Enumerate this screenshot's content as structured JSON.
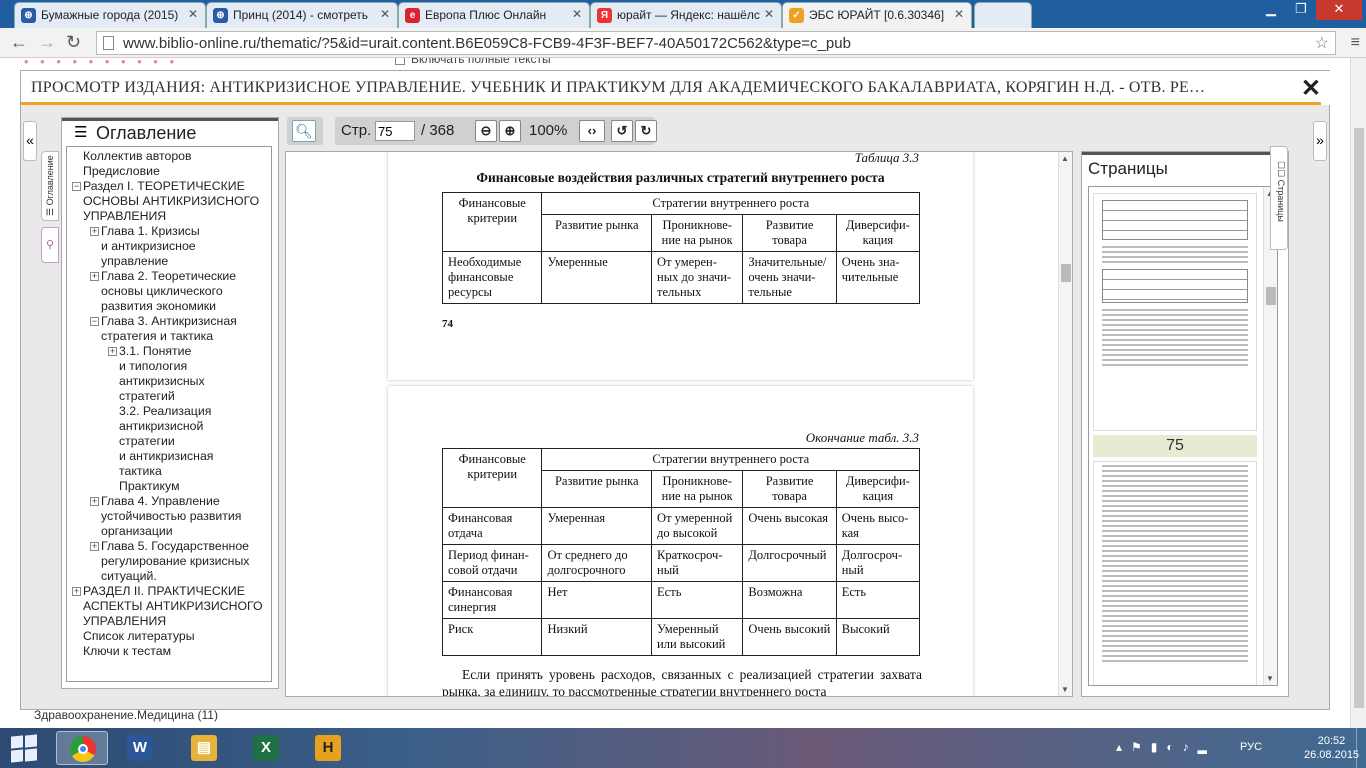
{
  "browser": {
    "tabs": [
      {
        "title": "Бумажные города (2015)",
        "favicon_color": "#2a5ba8",
        "left": 0
      },
      {
        "title": "Принц (2014) - смотреть",
        "favicon_color": "#2a5ba8",
        "left": 0
      },
      {
        "title": "Европа Плюс Онлайн",
        "favicon_color": "#d23",
        "left": 0
      },
      {
        "title": "юрайт — Яндекс: нашёлс",
        "favicon_color": "#e33",
        "left": 0
      },
      {
        "title": "ЭБС ЮРАЙТ [0.6.30346]",
        "favicon_color": "#f0a020",
        "left": 0
      }
    ],
    "url": "www.biblio-online.ru/thematic/?5&id=urait.content.B6E059C8-FCB9-4F3F-BEF7-40A50172C562&type=c_pub",
    "bg_checkbox_label": "Включать полные тексты",
    "bg_bottom_text": "Здравоохранение.Медицина (11)"
  },
  "viewer": {
    "title": "ПРОСМОТР ИЗДАНИЯ: АНТИКРИЗИСНОЕ УПРАВЛЕНИЕ. УЧЕБНИК И ПРАКТИКУМ ДЛЯ АКАДЕМИЧЕСКОГО БАКАЛАВРИАТА, КОРЯГИН Н.Д. - ОТВ. РЕ…",
    "close_symbol": "✕",
    "accent": "#f5a020",
    "toc_sidetab_label": "☰ Оглавление",
    "thumb_sidetab_label": "☐☐ Страницы",
    "toc": {
      "heading": "Оглавление",
      "items": [
        {
          "text": "Коллектив авторов",
          "indent": 0,
          "exp": ""
        },
        {
          "text": "Предисловие",
          "indent": 0,
          "exp": ""
        },
        {
          "text": "Раздел I. ТЕОРЕТИЧЕСКИЕ",
          "indent": 0,
          "exp": "−"
        },
        {
          "text": "ОСНОВЫ АНТИКРИЗИСНОГО",
          "indent": 0,
          "exp": ""
        },
        {
          "text": "УПРАВЛЕНИЯ",
          "indent": 0,
          "exp": ""
        },
        {
          "text": "Глава 1. Кризисы",
          "indent": 1,
          "exp": "+"
        },
        {
          "text": "и антикризисное",
          "indent": 1,
          "exp": ""
        },
        {
          "text": "управление",
          "indent": 1,
          "exp": ""
        },
        {
          "text": "Глава 2. Теоретические",
          "indent": 1,
          "exp": "+"
        },
        {
          "text": "основы циклического",
          "indent": 1,
          "exp": ""
        },
        {
          "text": "развития экономики",
          "indent": 1,
          "exp": ""
        },
        {
          "text": "Глава 3. Антикризисная",
          "indent": 1,
          "exp": "−"
        },
        {
          "text": "стратегия и тактика",
          "indent": 1,
          "exp": ""
        },
        {
          "text": "3.1. Понятие",
          "indent": 2,
          "exp": "+"
        },
        {
          "text": "и типология",
          "indent": 2,
          "exp": ""
        },
        {
          "text": "антикризисных",
          "indent": 2,
          "exp": ""
        },
        {
          "text": "стратегий",
          "indent": 2,
          "exp": ""
        },
        {
          "text": "3.2. Реализация",
          "indent": 2,
          "exp": ""
        },
        {
          "text": "антикризисной",
          "indent": 2,
          "exp": ""
        },
        {
          "text": "стратегии",
          "indent": 2,
          "exp": ""
        },
        {
          "text": "и антикризисная",
          "indent": 2,
          "exp": ""
        },
        {
          "text": "тактика",
          "indent": 2,
          "exp": ""
        },
        {
          "text": "Практикум",
          "indent": 2,
          "exp": ""
        },
        {
          "text": "Глава 4. Управление",
          "indent": 1,
          "exp": "+"
        },
        {
          "text": "устойчивостью развития",
          "indent": 1,
          "exp": ""
        },
        {
          "text": "организации",
          "indent": 1,
          "exp": ""
        },
        {
          "text": "Глава 5. Государственное",
          "indent": 1,
          "exp": "+"
        },
        {
          "text": "регулирование кризисных",
          "indent": 1,
          "exp": ""
        },
        {
          "text": "ситуаций.",
          "indent": 1,
          "exp": ""
        },
        {
          "text": "РАЗДЕЛ II. ПРАКТИЧЕСКИЕ",
          "indent": 0,
          "exp": "+"
        },
        {
          "text": "АСПЕКТЫ АНТИКРИЗИСНОГО",
          "indent": 0,
          "exp": ""
        },
        {
          "text": "УПРАВЛЕНИЯ",
          "indent": 0,
          "exp": ""
        },
        {
          "text": "Список литературы",
          "indent": 0,
          "exp": ""
        },
        {
          "text": "Ключи к тестам",
          "indent": 0,
          "exp": ""
        }
      ]
    },
    "pager": {
      "label": "Стр.",
      "current": "75",
      "total": "/ 368",
      "zoom": "100%"
    },
    "doc": {
      "page1": {
        "caption": "Таблица 3.3",
        "title": "Финансовые воздействия различных стратегий внутреннего роста",
        "head_criteria": "Финансовые критерии",
        "head_strategies": "Стратегии внутреннего роста",
        "cols": [
          "Развитие рынка",
          "Проникнове-ние на рынок",
          "Развитие товара",
          "Диверсифи-кация"
        ],
        "rows": [
          [
            "Необходимые финансовые ресурсы",
            "Умеренные",
            "От умерен-ных до значи-тельных",
            "Значительные/ очень значи-тельные",
            "Очень зна-чительные"
          ]
        ],
        "page_number": "74"
      },
      "page2": {
        "caption": "Окончание табл. 3.3",
        "head_criteria": "Финансовые критерии",
        "head_strategies": "Стратегии внутреннего роста",
        "cols": [
          "Развитие рынка",
          "Проникнове-ние на рынок",
          "Развитие товара",
          "Диверсифи-кация"
        ],
        "rows": [
          [
            "Финансовая отдача",
            "Умеренная",
            "От умеренной до высокой",
            "Очень высокая",
            "Очень высо-кая"
          ],
          [
            "Период финан-совой отдачи",
            "От среднего до долгосрочного",
            "Краткосроч-ный",
            "Долгосрочный",
            "Долгосроч-ный"
          ],
          [
            "Финансовая синергия",
            "Нет",
            "Есть",
            "Возможна",
            "Есть"
          ],
          [
            "Риск",
            "Низкий",
            "Умеренный или высокий",
            "Очень высокий",
            "Высокий"
          ]
        ],
        "paragraph": "Если принять уровень расходов, связанных с реализацией стратегии захвата рынка, за единицу, то рассмотренные стратегии внутреннего роста"
      }
    },
    "thumbs": {
      "heading": "Страницы",
      "current_label": "75"
    }
  },
  "taskbar": {
    "apps": [
      {
        "name": "chrome",
        "label": "",
        "color": "#e33",
        "active": true
      },
      {
        "name": "word",
        "label": "W",
        "color": "#2b5797",
        "active": false
      },
      {
        "name": "explorer",
        "label": "▤",
        "color": "#e8b33a",
        "active": false
      },
      {
        "name": "excel",
        "label": "X",
        "color": "#1e7145",
        "active": false
      },
      {
        "name": "h-app",
        "label": "H",
        "color": "#e8a020",
        "active": false
      }
    ],
    "lang": "РУС",
    "time": "20:52",
    "date": "26.08.2015"
  }
}
